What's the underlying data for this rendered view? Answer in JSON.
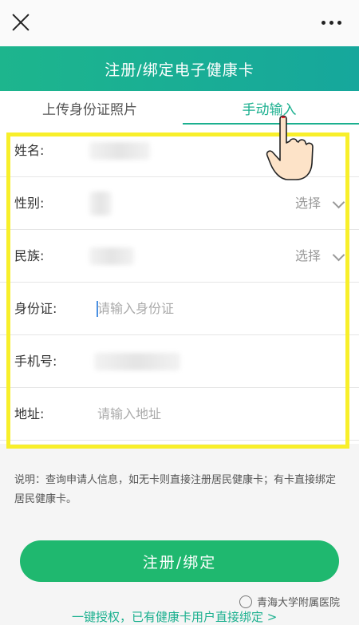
{
  "header": {
    "title": "注册/绑定电子健康卡"
  },
  "tabs": [
    {
      "label": "上传身份证照片",
      "active": false
    },
    {
      "label": "手动输入",
      "active": true
    }
  ],
  "form": {
    "name_label": "姓名:",
    "gender_label": "性别:",
    "gender_select": "选择",
    "ethnicity_label": "民族:",
    "ethnicity_select": "选择",
    "id_label": "身份证:",
    "id_placeholder": "请输入身份证",
    "phone_label": "手机号:",
    "address_label": "地址:",
    "address_placeholder": "请输入地址"
  },
  "note": "说明：查询申请人信息，如无卡则直接注册居民健康卡；有卡直接绑定居民健康卡。",
  "submit_label": "注册/绑定",
  "bottom_link": "一键授权，已有健康卡用户直接绑定 >",
  "watermark": "青海大学附属医院",
  "colors": {
    "accent": "#1bb08f",
    "button": "#1fb86f",
    "highlight": "#f8ef2a"
  }
}
